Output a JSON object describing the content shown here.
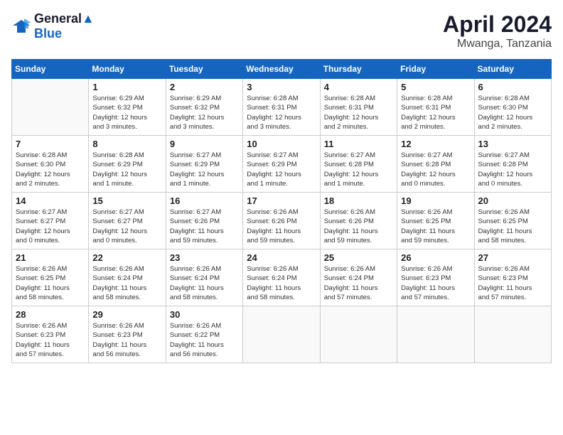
{
  "header": {
    "logo_line1": "General",
    "logo_line2": "Blue",
    "month": "April 2024",
    "location": "Mwanga, Tanzania"
  },
  "days_of_week": [
    "Sunday",
    "Monday",
    "Tuesday",
    "Wednesday",
    "Thursday",
    "Friday",
    "Saturday"
  ],
  "weeks": [
    [
      {
        "day": "",
        "info": ""
      },
      {
        "day": "1",
        "info": "Sunrise: 6:29 AM\nSunset: 6:32 PM\nDaylight: 12 hours\nand 3 minutes."
      },
      {
        "day": "2",
        "info": "Sunrise: 6:29 AM\nSunset: 6:32 PM\nDaylight: 12 hours\nand 3 minutes."
      },
      {
        "day": "3",
        "info": "Sunrise: 6:28 AM\nSunset: 6:31 PM\nDaylight: 12 hours\nand 3 minutes."
      },
      {
        "day": "4",
        "info": "Sunrise: 6:28 AM\nSunset: 6:31 PM\nDaylight: 12 hours\nand 2 minutes."
      },
      {
        "day": "5",
        "info": "Sunrise: 6:28 AM\nSunset: 6:31 PM\nDaylight: 12 hours\nand 2 minutes."
      },
      {
        "day": "6",
        "info": "Sunrise: 6:28 AM\nSunset: 6:30 PM\nDaylight: 12 hours\nand 2 minutes."
      }
    ],
    [
      {
        "day": "7",
        "info": "Sunrise: 6:28 AM\nSunset: 6:30 PM\nDaylight: 12 hours\nand 2 minutes."
      },
      {
        "day": "8",
        "info": "Sunrise: 6:28 AM\nSunset: 6:29 PM\nDaylight: 12 hours\nand 1 minute."
      },
      {
        "day": "9",
        "info": "Sunrise: 6:27 AM\nSunset: 6:29 PM\nDaylight: 12 hours\nand 1 minute."
      },
      {
        "day": "10",
        "info": "Sunrise: 6:27 AM\nSunset: 6:29 PM\nDaylight: 12 hours\nand 1 minute."
      },
      {
        "day": "11",
        "info": "Sunrise: 6:27 AM\nSunset: 6:28 PM\nDaylight: 12 hours\nand 1 minute."
      },
      {
        "day": "12",
        "info": "Sunrise: 6:27 AM\nSunset: 6:28 PM\nDaylight: 12 hours\nand 0 minutes."
      },
      {
        "day": "13",
        "info": "Sunrise: 6:27 AM\nSunset: 6:28 PM\nDaylight: 12 hours\nand 0 minutes."
      }
    ],
    [
      {
        "day": "14",
        "info": "Sunrise: 6:27 AM\nSunset: 6:27 PM\nDaylight: 12 hours\nand 0 minutes."
      },
      {
        "day": "15",
        "info": "Sunrise: 6:27 AM\nSunset: 6:27 PM\nDaylight: 12 hours\nand 0 minutes."
      },
      {
        "day": "16",
        "info": "Sunrise: 6:27 AM\nSunset: 6:26 PM\nDaylight: 11 hours\nand 59 minutes."
      },
      {
        "day": "17",
        "info": "Sunrise: 6:26 AM\nSunset: 6:26 PM\nDaylight: 11 hours\nand 59 minutes."
      },
      {
        "day": "18",
        "info": "Sunrise: 6:26 AM\nSunset: 6:26 PM\nDaylight: 11 hours\nand 59 minutes."
      },
      {
        "day": "19",
        "info": "Sunrise: 6:26 AM\nSunset: 6:25 PM\nDaylight: 11 hours\nand 59 minutes."
      },
      {
        "day": "20",
        "info": "Sunrise: 6:26 AM\nSunset: 6:25 PM\nDaylight: 11 hours\nand 58 minutes."
      }
    ],
    [
      {
        "day": "21",
        "info": "Sunrise: 6:26 AM\nSunset: 6:25 PM\nDaylight: 11 hours\nand 58 minutes."
      },
      {
        "day": "22",
        "info": "Sunrise: 6:26 AM\nSunset: 6:24 PM\nDaylight: 11 hours\nand 58 minutes."
      },
      {
        "day": "23",
        "info": "Sunrise: 6:26 AM\nSunset: 6:24 PM\nDaylight: 11 hours\nand 58 minutes."
      },
      {
        "day": "24",
        "info": "Sunrise: 6:26 AM\nSunset: 6:24 PM\nDaylight: 11 hours\nand 58 minutes."
      },
      {
        "day": "25",
        "info": "Sunrise: 6:26 AM\nSunset: 6:24 PM\nDaylight: 11 hours\nand 57 minutes."
      },
      {
        "day": "26",
        "info": "Sunrise: 6:26 AM\nSunset: 6:23 PM\nDaylight: 11 hours\nand 57 minutes."
      },
      {
        "day": "27",
        "info": "Sunrise: 6:26 AM\nSunset: 6:23 PM\nDaylight: 11 hours\nand 57 minutes."
      }
    ],
    [
      {
        "day": "28",
        "info": "Sunrise: 6:26 AM\nSunset: 6:23 PM\nDaylight: 11 hours\nand 57 minutes."
      },
      {
        "day": "29",
        "info": "Sunrise: 6:26 AM\nSunset: 6:23 PM\nDaylight: 11 hours\nand 56 minutes."
      },
      {
        "day": "30",
        "info": "Sunrise: 6:26 AM\nSunset: 6:22 PM\nDaylight: 11 hours\nand 56 minutes."
      },
      {
        "day": "",
        "info": ""
      },
      {
        "day": "",
        "info": ""
      },
      {
        "day": "",
        "info": ""
      },
      {
        "day": "",
        "info": ""
      }
    ]
  ]
}
